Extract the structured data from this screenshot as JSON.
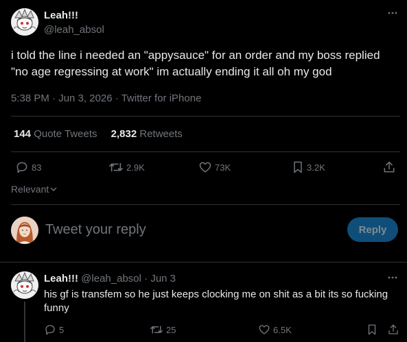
{
  "tweet": {
    "author_name": "Leah!!!",
    "author_handle": "@leah_absol",
    "text_line1": "i told the line i needed an \"appysauce\" for an order and my boss replied",
    "text_line2": "\"no age regressing at work\" im actually ending it all oh my god",
    "time": "5:38 PM",
    "date": "Jun 3, 2026",
    "source": "Twitter for iPhone",
    "quote_count": "144",
    "quote_label": "Quote Tweets",
    "retweet_count": "2,832",
    "retweet_label": "Retweets",
    "replies": "83",
    "retweets_short": "2.9K",
    "likes": "73K",
    "bookmarks": "3.2K"
  },
  "sort": {
    "label": "Relevant"
  },
  "composer": {
    "placeholder": "Tweet your reply",
    "button_label": "Reply"
  },
  "reply": {
    "author_name": "Leah!!!",
    "author_handle": "@leah_absol",
    "date": "Jun 3",
    "text_line1": "his gf is transfem so he just keeps clocking me on shit as a bit its so fucking",
    "text_line2": "funny",
    "replies": "5",
    "retweets": "25",
    "likes": "6.5K"
  },
  "colors": {
    "background": "#000000",
    "text": "#e7e9ea",
    "muted": "#71767b",
    "divider": "#2f3336",
    "reply_button_bg": "#0f4e78"
  },
  "icons": [
    "more-icon",
    "reply-icon",
    "retweet-icon",
    "like-icon",
    "bookmark-icon",
    "share-icon",
    "chevron-down-icon"
  ]
}
